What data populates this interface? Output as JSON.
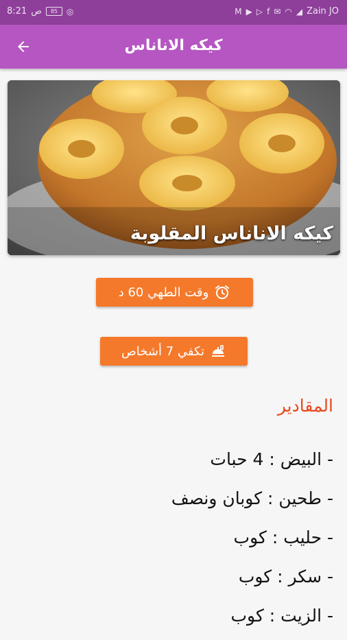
{
  "status_bar": {
    "time": "8:21",
    "am_pm": "ص",
    "battery": "85",
    "carrier": "Zain JO"
  },
  "app_bar": {
    "title": "كيكه الاناناس",
    "back_icon": "arrow-left-icon"
  },
  "hero": {
    "caption": "كيكه الاناناس المقلوبة"
  },
  "info": {
    "cook_time_label": "وقت الطهي 60 د",
    "cook_time_icon": "alarm-clock-icon",
    "serves_label": "تكفي 7 أشخاص",
    "serves_icon": "food-serving-icon"
  },
  "ingredients": {
    "title": "المقادير",
    "items": [
      "- البيض : 4 حبات",
      "- طحين : كوبان ونصف",
      "- حليب : كوب",
      "- سكر : كوب",
      "- الزيت : كوب"
    ]
  },
  "colors": {
    "status_bar": "#8e3f9a",
    "app_bar": "#b556c2",
    "accent_orange": "#f4792b",
    "section_title": "#e8481c"
  }
}
